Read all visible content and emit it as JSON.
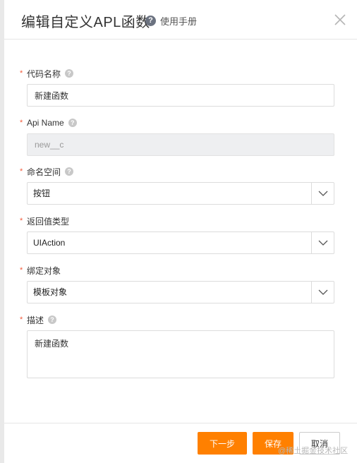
{
  "dialog": {
    "title": "编辑自定义APL函数",
    "help_label": "使用手册"
  },
  "fields": {
    "code_name": {
      "label": "代码名称",
      "value": "新建函数"
    },
    "api_name": {
      "label": "Api Name",
      "value": "new__c"
    },
    "namespace": {
      "label": "命名空间",
      "value": "按钮"
    },
    "return_type": {
      "label": "返回值类型",
      "value": "UIAction"
    },
    "bind_object": {
      "label": "绑定对象",
      "value": "模板对象"
    },
    "description": {
      "label": "描述",
      "value": "新建函数"
    }
  },
  "required_mark": "*",
  "footer": {
    "next_label": "下一步",
    "save_label": "保存",
    "cancel_label": "取消"
  },
  "watermark": "@稀土掘金技术社区",
  "colors": {
    "primary": "#ff8000",
    "required": "#f25c3c",
    "disabled_bg": "#eeeff1"
  }
}
